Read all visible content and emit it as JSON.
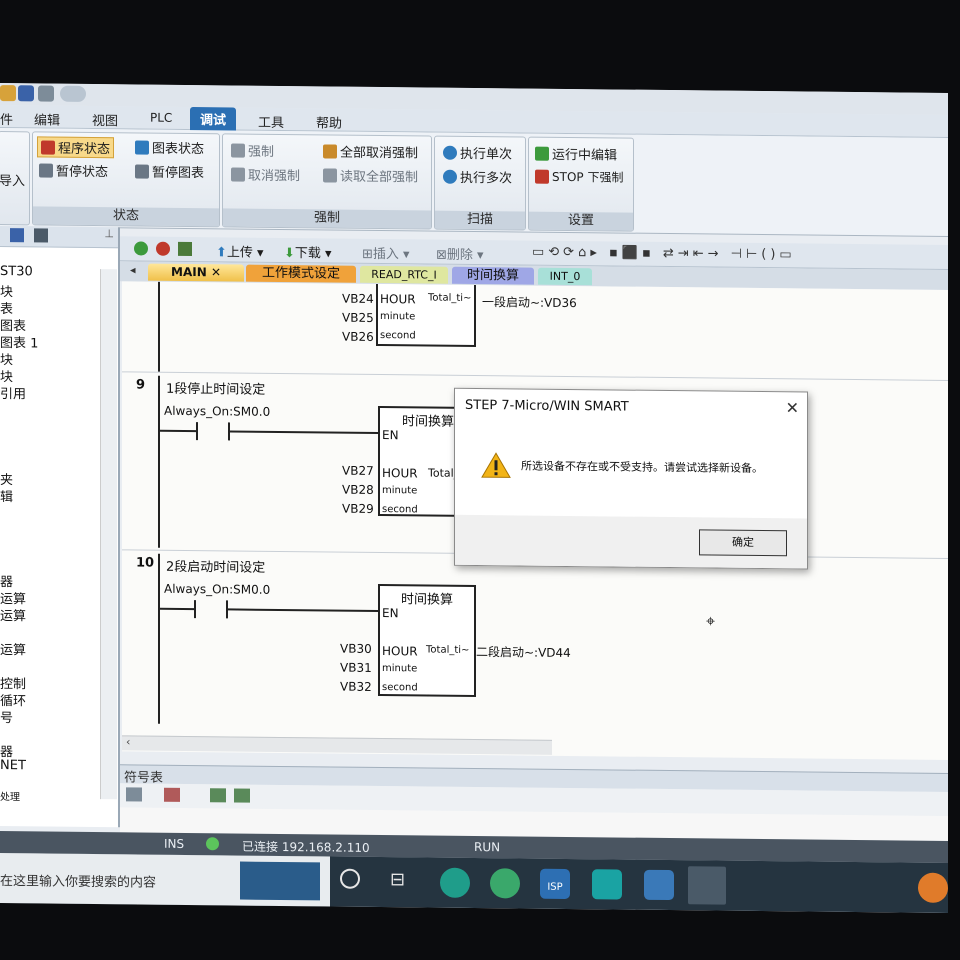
{
  "ribbon": {
    "tabs": [
      "件",
      "编辑",
      "视图",
      "PLC",
      "调试",
      "工具",
      "帮助"
    ],
    "active_tab": "调试",
    "groups": {
      "g0": {
        "items": [
          "导入"
        ]
      },
      "status": {
        "title": "状态",
        "items": [
          "程序状态",
          "暂停状态",
          "图表状态",
          "暂停图表"
        ]
      },
      "force": {
        "title": "强制",
        "items": [
          "强制",
          "取消强制",
          "全部取消强制",
          "读取全部强制"
        ]
      },
      "scan": {
        "title": "扫描",
        "items": [
          "执行单次",
          "执行多次"
        ]
      },
      "settings": {
        "title": "设置",
        "items": [
          "运行中编辑",
          "STOP 下强制"
        ]
      }
    }
  },
  "tree": {
    "items": [
      "ST30",
      "块",
      "表",
      "图表",
      "图表 1",
      "块",
      "块",
      "引用",
      "夹",
      "辑",
      "器",
      "运算",
      "运算",
      "运算",
      "控制",
      "循环",
      "号",
      "器",
      "NET",
      "处理"
    ]
  },
  "toolbar": {
    "upload": "上传",
    "download": "下载",
    "insert": "插入",
    "delete": "删除"
  },
  "program_tabs": [
    "MAIN",
    "工作模式设定",
    "READ_RTC_I",
    "时间换算",
    "INT_0"
  ],
  "ladder": {
    "top_partial": {
      "inputs": [
        "VB24",
        "VB25",
        "VB26"
      ],
      "pins": [
        "HOUR",
        "minute",
        "second"
      ],
      "output_pin": "Total_ti~",
      "output": "一段启动~:VD36"
    },
    "networks": [
      {
        "number": "9",
        "title": "1段停止时间设定",
        "contact": "Always_On:SM0.0",
        "block": "时间换算",
        "en": "EN",
        "inputs": [
          "VB27",
          "VB28",
          "VB29"
        ],
        "pins": [
          "HOUR",
          "minute",
          "second"
        ],
        "output_pin": "Total_"
      },
      {
        "number": "10",
        "title": "2段启动时间设定",
        "contact": "Always_On:SM0.0",
        "block": "时间换算",
        "en": "EN",
        "inputs": [
          "VB30",
          "VB31",
          "VB32"
        ],
        "pins": [
          "HOUR",
          "minute",
          "second"
        ],
        "output_pin": "Total_ti~",
        "output": "二段启动~:VD44"
      }
    ]
  },
  "dialog": {
    "title": "STEP 7-Micro/WIN SMART",
    "message": "所选设备不存在或不受支持。请尝试选择新设备。",
    "ok": "确定",
    "close": "✕"
  },
  "symbol_table": {
    "title": "符号表"
  },
  "statusbar": {
    "mode": "INS",
    "connection": "已连接 192.168.2.110",
    "run": "RUN"
  },
  "taskbar": {
    "search_placeholder": "在这里输入你要搜索的内容",
    "app_isp": "ISP"
  },
  "colors": {
    "accent": "#2b6fb3",
    "status_bar": "#4a5561",
    "taskbar": "#253440"
  }
}
